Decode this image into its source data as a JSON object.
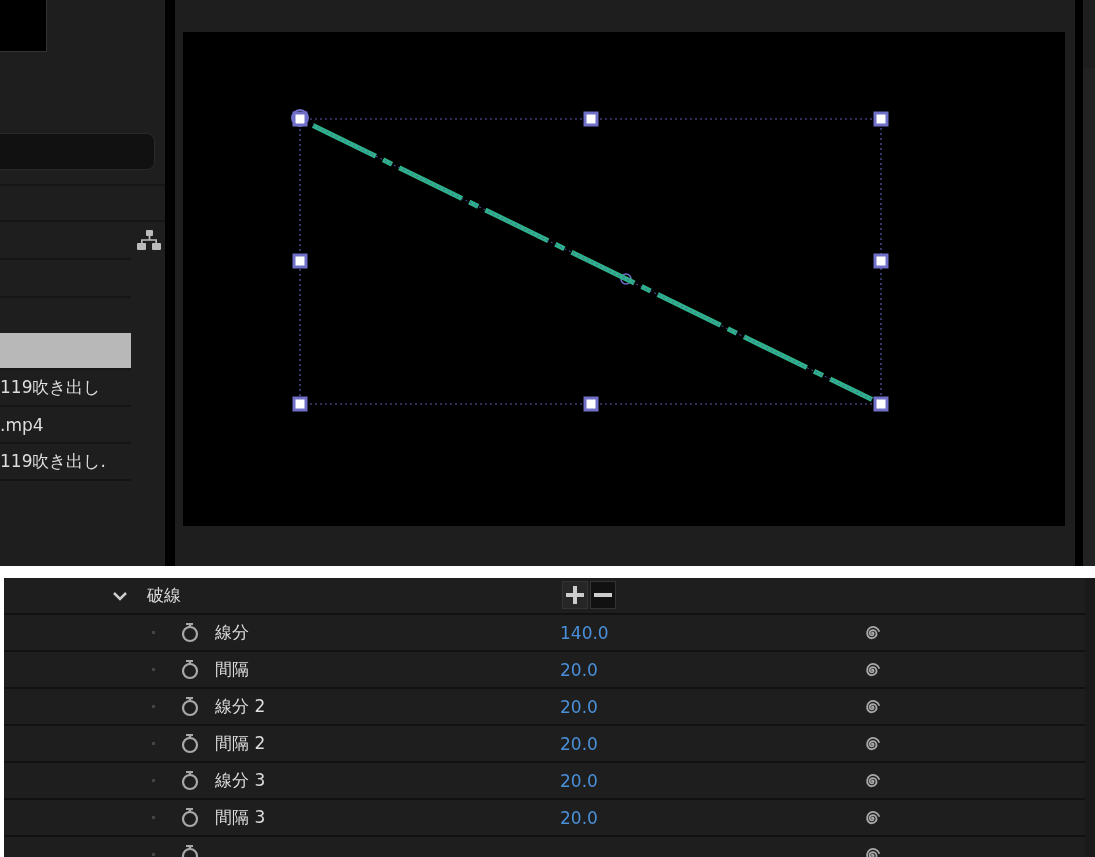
{
  "library": {
    "items": [
      {
        "selected": true
      },
      {
        "label": "119吹き出し",
        "selected": false
      },
      {
        "label": ".mp4",
        "selected": false
      },
      {
        "label": "119吹き出し.",
        "selected": false
      }
    ]
  },
  "properties": {
    "group": {
      "label": "破線",
      "expanded": true
    },
    "params": [
      {
        "label": "線分",
        "value": "140.0"
      },
      {
        "label": "間隔",
        "value": "20.0"
      },
      {
        "label": "線分 2",
        "value": "20.0"
      },
      {
        "label": "間隔 2",
        "value": "20.0"
      },
      {
        "label": "線分 3",
        "value": "20.0"
      },
      {
        "label": "間隔 3",
        "value": "20.0"
      }
    ]
  }
}
